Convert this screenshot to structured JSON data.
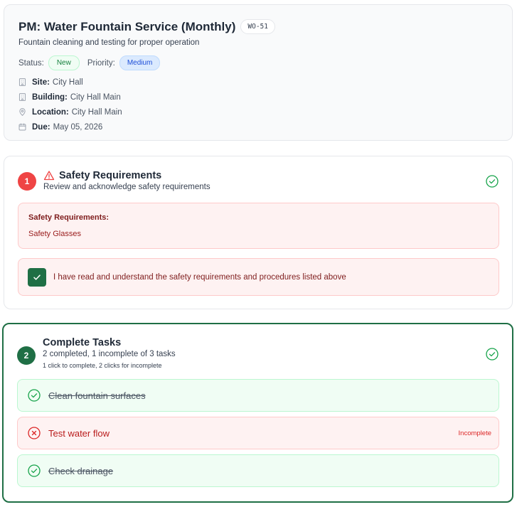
{
  "work_order": {
    "title": "PM: Water Fountain Service (Monthly)",
    "id": "WO-51",
    "description": "Fountain cleaning and testing for proper operation",
    "status_label": "Status:",
    "status": "New",
    "priority_label": "Priority:",
    "priority": "Medium",
    "meta": [
      {
        "icon": "building-icon",
        "key": "Site:",
        "value": "City Hall"
      },
      {
        "icon": "building-icon",
        "key": "Building:",
        "value": "City Hall Main"
      },
      {
        "icon": "location-pin-icon",
        "key": "Location:",
        "value": "City Hall Main"
      },
      {
        "icon": "calendar-icon",
        "key": "Due:",
        "value": "May 05, 2026"
      }
    ]
  },
  "safety": {
    "step": "1",
    "title": "Safety Requirements",
    "subtitle": "Review and acknowledge safety requirements",
    "box_title": "Safety Requirements:",
    "items": [
      "Safety Glasses"
    ],
    "acknowledgement": "I have read and understand the safety requirements and procedures listed above",
    "acknowledged": true,
    "completed": true
  },
  "tasks": {
    "step": "2",
    "title": "Complete Tasks",
    "summary": "2 completed, 1 incomplete of 3 tasks",
    "hint": "1 click to complete, 2 clicks for incomplete",
    "completed": true,
    "items": [
      {
        "label": "Clean fountain surfaces",
        "state": "complete",
        "status_text": ""
      },
      {
        "label": "Test water flow",
        "state": "incomplete",
        "status_text": "Incomplete"
      },
      {
        "label": "Check drainage",
        "state": "complete",
        "status_text": ""
      }
    ]
  },
  "colors": {
    "accent_green": "#1f6f45",
    "danger_red": "#ef4444"
  }
}
